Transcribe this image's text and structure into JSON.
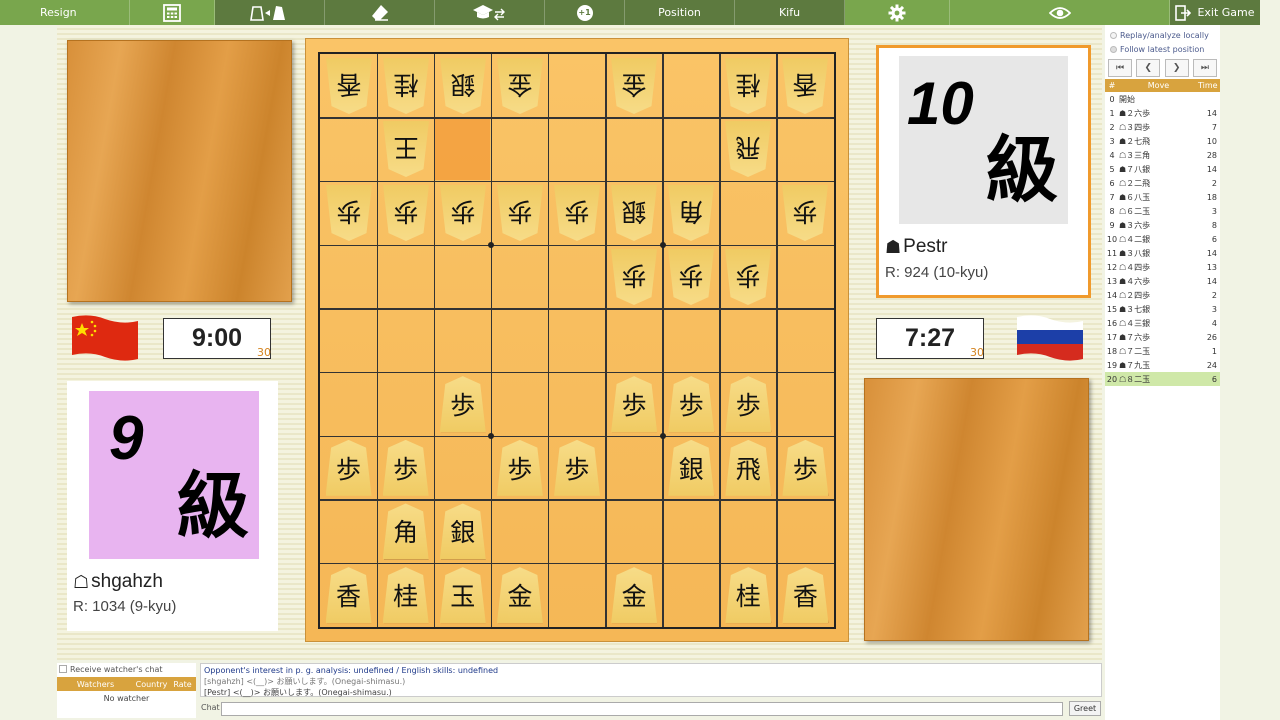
{
  "toolbar": {
    "resign": "Resign",
    "position": "Position",
    "kifu": "Kifu",
    "exit": "Exit Game",
    "plus_one": "+1"
  },
  "colors": {
    "toolbar_dark": "#5d7a3f",
    "toolbar_light": "#79a64d",
    "accent": "#d8a33e"
  },
  "left_player": {
    "clock": "9:00",
    "byoyomi": "30",
    "rank_number": "9",
    "rank_kanji": "級",
    "name": "shgahzh",
    "rating": "R: 1034 (9-kyu)",
    "mark": "☖",
    "flag": "china-flag-icon"
  },
  "right_player": {
    "clock": "7:27",
    "byoyomi": "30",
    "rank_number": "10",
    "rank_kanji": "級",
    "name": "Pestr",
    "rating": "R: 924 (10-kyu)",
    "mark": "☗",
    "flag": "russia-flag-icon"
  },
  "board": {
    "rows": [
      [
        "g:香",
        "g:桂",
        "g:銀",
        "g:金",
        "",
        "g:金",
        "",
        "g:桂",
        "g:香"
      ],
      [
        "",
        "g:王",
        "",
        "",
        "",
        "",
        "",
        "g:飛",
        ""
      ],
      [
        "g:歩",
        "g:歩",
        "g:歩",
        "g:歩",
        "g:歩",
        "g:銀",
        "g:角",
        "",
        "g:歩"
      ],
      [
        "",
        "",
        "",
        "",
        "",
        "g:歩",
        "g:歩",
        "g:歩",
        ""
      ],
      [
        "",
        "",
        "",
        "",
        "",
        "",
        "",
        "",
        ""
      ],
      [
        "",
        "",
        "s:歩",
        "",
        "",
        "s:歩",
        "s:歩",
        "s:歩",
        ""
      ],
      [
        "s:歩",
        "s:歩",
        "",
        "s:歩",
        "s:歩",
        "",
        "s:銀",
        "s:飛",
        "s:歩"
      ],
      [
        "",
        "s:角",
        "s:銀",
        "",
        "",
        "",
        "",
        "",
        ""
      ],
      [
        "s:香",
        "s:桂",
        "s:玉",
        "s:金",
        "",
        "s:金",
        "",
        "s:桂",
        "s:香"
      ]
    ],
    "last_move_cell": [
      1,
      2
    ]
  },
  "analysis": {
    "replay_label": "Replay/analyze locally",
    "follow_label": "Follow latest position"
  },
  "kifu": {
    "headers": [
      "#",
      "Move",
      "Time"
    ],
    "moves": [
      {
        "n": "0",
        "m": "開始",
        "t": ""
      },
      {
        "n": "1",
        "m": "☗２六歩",
        "t": "14"
      },
      {
        "n": "2",
        "m": "☖３四歩",
        "t": "7"
      },
      {
        "n": "3",
        "m": "☗２七飛",
        "t": "10"
      },
      {
        "n": "4",
        "m": "☖３三角",
        "t": "28"
      },
      {
        "n": "5",
        "m": "☗７八銀",
        "t": "14"
      },
      {
        "n": "6",
        "m": "☖２二飛",
        "t": "2"
      },
      {
        "n": "7",
        "m": "☗６八玉",
        "t": "18"
      },
      {
        "n": "8",
        "m": "☖６二玉",
        "t": "3"
      },
      {
        "n": "9",
        "m": "☗３六歩",
        "t": "8"
      },
      {
        "n": "10",
        "m": "☖４二銀",
        "t": "6"
      },
      {
        "n": "11",
        "m": "☗３八銀",
        "t": "14"
      },
      {
        "n": "12",
        "m": "☖４四歩",
        "t": "13"
      },
      {
        "n": "13",
        "m": "☗４六歩",
        "t": "14"
      },
      {
        "n": "14",
        "m": "☖２四歩",
        "t": "2"
      },
      {
        "n": "15",
        "m": "☗３七銀",
        "t": "3"
      },
      {
        "n": "16",
        "m": "☖４三銀",
        "t": "4"
      },
      {
        "n": "17",
        "m": "☗７六歩",
        "t": "26"
      },
      {
        "n": "18",
        "m": "☖７二玉",
        "t": "1"
      },
      {
        "n": "19",
        "m": "☗７九玉",
        "t": "24"
      },
      {
        "n": "20",
        "m": "☖８二玉",
        "t": "6"
      }
    ]
  },
  "watchers": {
    "checkbox_label": "Receive watcher's chat",
    "headers": [
      "Watchers",
      "Country",
      "Rate"
    ],
    "empty": "No watcher"
  },
  "chat": {
    "lines": [
      "Opponent's interest in p. g. analysis: undefined / English skills: undefined",
      "[shgahzh] <(__)> お願いします。(Onegai-shimasu.)",
      "[Pestr] <(__)> お願いします。(Onegai-shimasu.)"
    ],
    "label": "Chat",
    "input_value": "",
    "greet": "Greet"
  }
}
